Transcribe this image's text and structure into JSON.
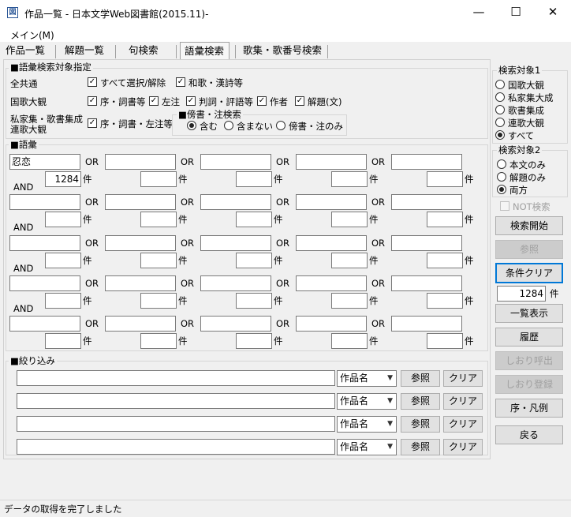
{
  "window": {
    "title": "作品一覧 - 日本文学Web図書館(2015.11)-",
    "app_icon_glyph": "図",
    "minimize_glyph": "—",
    "maximize_glyph": "☐",
    "close_glyph": "✕"
  },
  "menu": {
    "main_label": "メイン(M)"
  },
  "tabs": {
    "sakuhin": "作品一覧",
    "kaidai": "解題一覧",
    "ku": "句検索",
    "goi": "語彙検索",
    "kashu": "歌集・歌番号検索"
  },
  "target_spec": {
    "title": "■語彙検索対象指定",
    "all_label": "全共通",
    "all_select": "すべて選択/解除",
    "waka": "和歌・漢詩等",
    "kokka_label": "国歌大観",
    "jo_kotobagaki": "序・詞書等",
    "sachu": "左注",
    "hanshi": "判詞・評語等",
    "sakusha": "作者",
    "kaidai_bun": "解題(文)",
    "shika_label_1": "私家集・歌書集成",
    "shika_label_2": "連歌大観",
    "jo_sachu": "序・詞書・左注等",
    "bosho_title": "■傍書・注検索",
    "fukumu": "含む",
    "fukumanai": "含まない",
    "bosho_only": "傍書・注のみ"
  },
  "goi": {
    "title": "■語彙",
    "or_label": "OR",
    "and_label": "AND",
    "ken_label": "件",
    "first_term": "忍恋",
    "first_count": "1284"
  },
  "filter": {
    "title": "■絞り込み",
    "field_option": "作品名",
    "ref_button": "参照",
    "clear_button": "クリア"
  },
  "target1": {
    "title": "検索対象1",
    "options": [
      "国歌大観",
      "私家集大成",
      "歌書集成",
      "連歌大観",
      "すべて"
    ],
    "selected": "すべて"
  },
  "target2": {
    "title": "検索対象2",
    "options": [
      "本文のみ",
      "解題のみ",
      "両方"
    ],
    "selected": "両方"
  },
  "side": {
    "not_search": "NOT検索",
    "search_start": "検索開始",
    "reference": "参照",
    "condition_clear": "条件クリア",
    "total_count": "1284",
    "ken": "件",
    "list_display": "一覧表示",
    "history": "履歴",
    "bookmark_call": "しおり呼出",
    "bookmark_register": "しおり登録",
    "preface_legend": "序・凡例",
    "back": "戻る"
  },
  "status": {
    "message": "データの取得を完了しました"
  }
}
